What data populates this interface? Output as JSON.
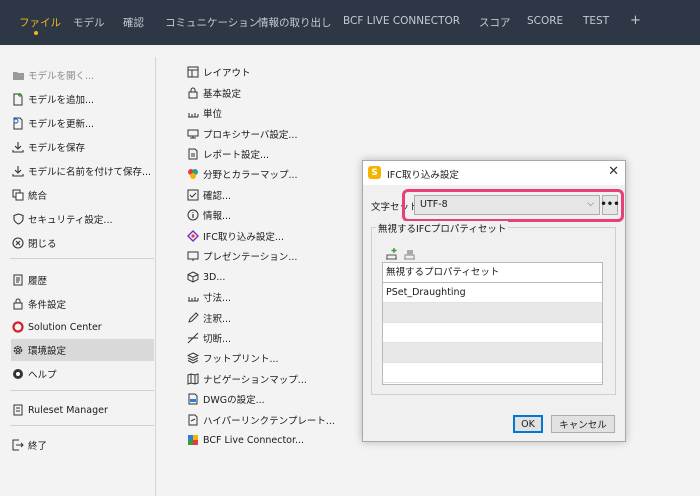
{
  "menu_bar": {
    "tabs": [
      "ファイル",
      "モデル",
      "確認",
      "コミュニケーション",
      "情報の取り出し",
      "BCF LIVE CONNECTOR",
      "スコア",
      "SCORE",
      "TEST",
      "+"
    ],
    "active_tab": "ファイル",
    "accent_color": "#f2b818",
    "background_color": "#2e3745"
  },
  "left_menu": {
    "open_model": "モデルを開く...",
    "add_model": "モデルを追加...",
    "update_model": "モデルを更新...",
    "save_model": "モデルを保存",
    "save_model_as": "モデルに名前を付けて保存...",
    "merge": "統合",
    "security_settings": "セキュリティ設定...",
    "close": "閉じる",
    "history": "履歴",
    "condition_settings": "条件設定",
    "solution_center": "Solution Center",
    "environment_settings": "環境設定",
    "help": "ヘルプ",
    "ruleset_manager": "Ruleset Manager",
    "exit": "終了"
  },
  "settings_list": [
    {
      "label": "レイアウト",
      "icon": "layout-icon"
    },
    {
      "label": "基本設定",
      "icon": "lock-icon"
    },
    {
      "label": "単位",
      "icon": "ruler-icon"
    },
    {
      "label": "プロキシサーバ設定...",
      "icon": "proxy-icon"
    },
    {
      "label": "レポート設定...",
      "icon": "report-icon"
    },
    {
      "label": "分野とカラーマップ...",
      "icon": "color-map-icon"
    },
    {
      "label": "確認...",
      "icon": "check-icon"
    },
    {
      "label": "情報...",
      "icon": "info-icon"
    },
    {
      "label": "IFC取り込み設定...",
      "icon": "ifc-icon"
    },
    {
      "label": "プレゼンテーション...",
      "icon": "presentation-icon"
    },
    {
      "label": "3D...",
      "icon": "cube-icon"
    },
    {
      "label": "寸法...",
      "icon": "dimension-icon"
    },
    {
      "label": "注釈...",
      "icon": "pencil-icon"
    },
    {
      "label": "切断...",
      "icon": "cut-icon"
    },
    {
      "label": "フットプリント...",
      "icon": "layers-icon"
    },
    {
      "label": "ナビゲーションマップ...",
      "icon": "navigation-map-icon"
    },
    {
      "label": "DWGの設定...",
      "icon": "dwg-icon"
    },
    {
      "label": "ハイパーリンクテンプレート...",
      "icon": "hyperlink-icon"
    },
    {
      "label": "BCF Live Connector...",
      "icon": "bcf-icon"
    }
  ],
  "dialog": {
    "title": "IFC取り込み設定",
    "charset_label": "文字セット",
    "charset_value": "UTF-8",
    "ellipsis": "•••",
    "group_label": "無視するIFCプロパティセット",
    "list_header": "無視するプロパティセット",
    "rows": [
      "PSet_Draughting",
      "",
      "",
      "",
      ""
    ],
    "ok": "OK",
    "cancel": "キャンセル",
    "highlight_color": "#e83e79"
  }
}
